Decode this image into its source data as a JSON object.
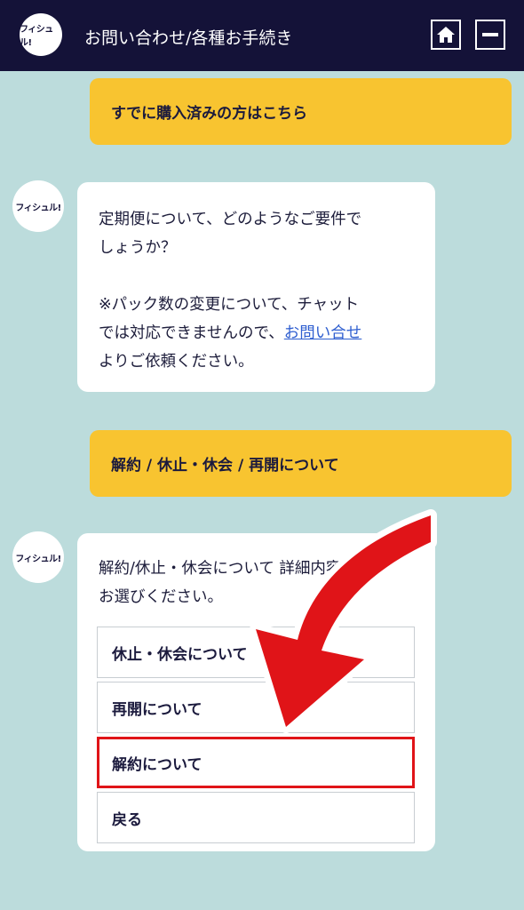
{
  "header": {
    "logo_text": "フィシュル!",
    "title": "お問い合わせ/各種お手続き",
    "home_icon": "home-icon",
    "minimize_icon": "minimize-icon"
  },
  "messages": {
    "purchased_button": "すでに購入済みの方はこちら",
    "bot_avatar_text": "フィシュル!",
    "bot1": {
      "line1": "定期便について、どのようなご要件で",
      "line2": "しょうか？",
      "line3": "※パック数の変更について、チャット",
      "line4_pre": "では対応できませんので、",
      "link": "お問い合せ",
      "line5": "よりご依頼ください。"
    },
    "user_choice": "解約 / 休止・休会 / 再開について",
    "bot2": {
      "line1": "解約/休止・休会について 詳細内容を",
      "line2": "お選びください。"
    }
  },
  "options": [
    {
      "label": "休止・休会について"
    },
    {
      "label": "再開について"
    },
    {
      "label": "解約について"
    },
    {
      "label": "戻る"
    }
  ],
  "colors": {
    "header_bg": "#141238",
    "page_bg": "#bcdcdc",
    "accent_yellow": "#f8c430",
    "highlight_red": "#e01418",
    "link_blue": "#2f5fd0"
  }
}
